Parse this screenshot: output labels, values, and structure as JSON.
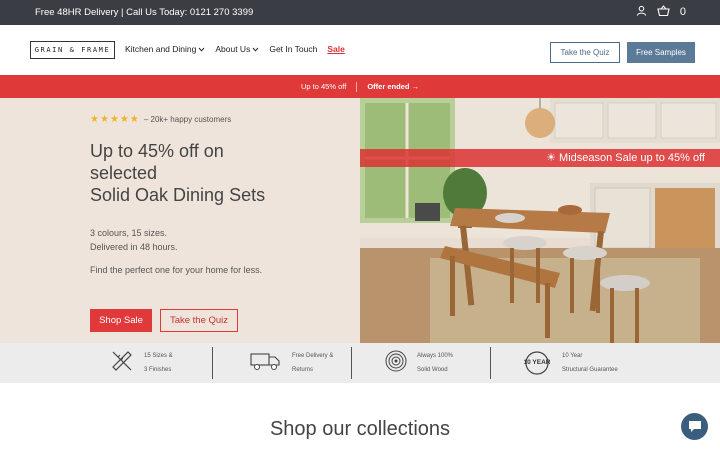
{
  "topbar": {
    "message": "Free 48HR Delivery | Call Us Today: 0121 270 3399",
    "cart_count": "0"
  },
  "nav": {
    "logo": "GRAIN & FRAME",
    "menu": [
      "Kitchen and Dining",
      "About Us",
      "Get In Touch",
      "Sale"
    ],
    "quiz_button": "Take the Quiz",
    "samples_button": "Free Samples"
  },
  "promo": {
    "offer": "Up to 45% off",
    "ended": "Offer ended →"
  },
  "hero": {
    "reviews": "– 20k+ happy customers",
    "title_line1": "Up to 45% off on",
    "title_line2": "selected",
    "title_line3": "Solid Oak Dining Sets",
    "sub_line1": "3 colours, 15 sizes.",
    "sub_line2": "Delivered in 48 hours.",
    "find": "Find the perfect one for your home for less.",
    "shop_button": "Shop Sale",
    "quiz_button": "Take the Quiz",
    "sale_banner": "☀ Midseason Sale up to 45% off"
  },
  "features": [
    {
      "line1": "15 Sizes &",
      "line2": "3 Finishes",
      "icon": "ruler-pencil-icon"
    },
    {
      "line1": "Free Delivery &",
      "line2": "Returns",
      "icon": "truck-icon"
    },
    {
      "line1": "Always 100%",
      "line2": "Solid Wood",
      "icon": "wood-rings-icon"
    },
    {
      "line1": "10 Year",
      "line2": "Structural Guarantee",
      "icon": "ten-year-badge-icon",
      "badge": "10 YEAR"
    }
  ],
  "collections_title": "Shop our collections",
  "colors": {
    "accent_red": "#e0393a",
    "navy": "#5a7a98",
    "hero_bg": "#efe4db"
  }
}
